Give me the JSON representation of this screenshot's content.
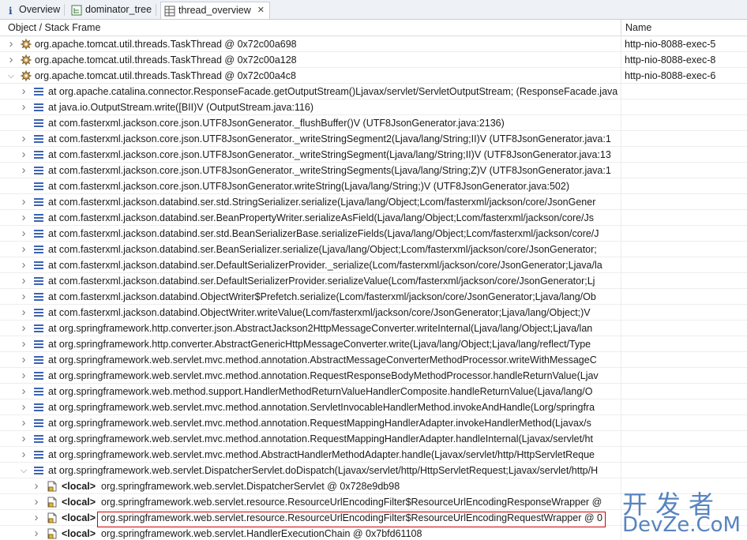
{
  "tabs": [
    {
      "label": "Overview",
      "icon": "info-icon"
    },
    {
      "label": "dominator_tree",
      "icon": "tree-table-icon"
    },
    {
      "label": "thread_overview",
      "icon": "thread-table-icon",
      "active": true
    }
  ],
  "columns": {
    "object": "Object / Stack Frame",
    "name": "Name"
  },
  "threads": [
    {
      "label": "org.apache.tomcat.util.threads.TaskThread @ 0x72c00a698",
      "name": "http-nio-8088-exec-5",
      "expanded": false
    },
    {
      "label": "org.apache.tomcat.util.threads.TaskThread @ 0x72c00a128",
      "name": "http-nio-8088-exec-8",
      "expanded": false
    },
    {
      "label": "org.apache.tomcat.util.threads.TaskThread @ 0x72c00a4c8",
      "name": "http-nio-8088-exec-6",
      "expanded": true
    }
  ],
  "frames": [
    {
      "text": "at org.apache.catalina.connector.ResponseFacade.getOutputStream()Ljavax/servlet/ServletOutputStream; (ResponseFacade.java",
      "chevron": true
    },
    {
      "text": "at java.io.OutputStream.write([BII)V (OutputStream.java:116)",
      "chevron": true
    },
    {
      "text": "at com.fasterxml.jackson.core.json.UTF8JsonGenerator._flushBuffer()V (UTF8JsonGenerator.java:2136)",
      "chevron": false
    },
    {
      "text": "at com.fasterxml.jackson.core.json.UTF8JsonGenerator._writeStringSegment2(Ljava/lang/String;II)V (UTF8JsonGenerator.java:1",
      "chevron": true
    },
    {
      "text": "at com.fasterxml.jackson.core.json.UTF8JsonGenerator._writeStringSegment(Ljava/lang/String;II)V (UTF8JsonGenerator.java:13",
      "chevron": true
    },
    {
      "text": "at com.fasterxml.jackson.core.json.UTF8JsonGenerator._writeStringSegments(Ljava/lang/String;Z)V (UTF8JsonGenerator.java:1",
      "chevron": true
    },
    {
      "text": "at com.fasterxml.jackson.core.json.UTF8JsonGenerator.writeString(Ljava/lang/String;)V (UTF8JsonGenerator.java:502)",
      "chevron": false
    },
    {
      "text": "at com.fasterxml.jackson.databind.ser.std.StringSerializer.serialize(Ljava/lang/Object;Lcom/fasterxml/jackson/core/JsonGener",
      "chevron": true
    },
    {
      "text": "at com.fasterxml.jackson.databind.ser.BeanPropertyWriter.serializeAsField(Ljava/lang/Object;Lcom/fasterxml/jackson/core/Js",
      "chevron": true
    },
    {
      "text": "at com.fasterxml.jackson.databind.ser.std.BeanSerializerBase.serializeFields(Ljava/lang/Object;Lcom/fasterxml/jackson/core/J",
      "chevron": true
    },
    {
      "text": "at com.fasterxml.jackson.databind.ser.BeanSerializer.serialize(Ljava/lang/Object;Lcom/fasterxml/jackson/core/JsonGenerator;",
      "chevron": true
    },
    {
      "text": "at com.fasterxml.jackson.databind.ser.DefaultSerializerProvider._serialize(Lcom/fasterxml/jackson/core/JsonGenerator;Ljava/la",
      "chevron": true
    },
    {
      "text": "at com.fasterxml.jackson.databind.ser.DefaultSerializerProvider.serializeValue(Lcom/fasterxml/jackson/core/JsonGenerator;Lj",
      "chevron": true
    },
    {
      "text": "at com.fasterxml.jackson.databind.ObjectWriter$Prefetch.serialize(Lcom/fasterxml/jackson/core/JsonGenerator;Ljava/lang/Ob",
      "chevron": true
    },
    {
      "text": "at com.fasterxml.jackson.databind.ObjectWriter.writeValue(Lcom/fasterxml/jackson/core/JsonGenerator;Ljava/lang/Object;)V",
      "chevron": true
    },
    {
      "text": "at org.springframework.http.converter.json.AbstractJackson2HttpMessageConverter.writeInternal(Ljava/lang/Object;Ljava/lan",
      "chevron": true
    },
    {
      "text": "at org.springframework.http.converter.AbstractGenericHttpMessageConverter.write(Ljava/lang/Object;Ljava/lang/reflect/Type",
      "chevron": true
    },
    {
      "text": "at org.springframework.web.servlet.mvc.method.annotation.AbstractMessageConverterMethodProcessor.writeWithMessageC",
      "chevron": true
    },
    {
      "text": "at org.springframework.web.servlet.mvc.method.annotation.RequestResponseBodyMethodProcessor.handleReturnValue(Ljav",
      "chevron": true
    },
    {
      "text": "at org.springframework.web.method.support.HandlerMethodReturnValueHandlerComposite.handleReturnValue(Ljava/lang/O",
      "chevron": true
    },
    {
      "text": "at org.springframework.web.servlet.mvc.method.annotation.ServletInvocableHandlerMethod.invokeAndHandle(Lorg/springfra",
      "chevron": true
    },
    {
      "text": "at org.springframework.web.servlet.mvc.method.annotation.RequestMappingHandlerAdapter.invokeHandlerMethod(Ljavax/s",
      "chevron": true
    },
    {
      "text": "at org.springframework.web.servlet.mvc.method.annotation.RequestMappingHandlerAdapter.handleInternal(Ljavax/servlet/ht",
      "chevron": true
    },
    {
      "text": "at org.springframework.web.servlet.mvc.method.AbstractHandlerMethodAdapter.handle(Ljavax/servlet/http/HttpServletReque",
      "chevron": true
    },
    {
      "text": "at org.springframework.web.servlet.DispatcherServlet.doDispatch(Ljavax/servlet/http/HttpServletRequest;Ljavax/servlet/http/H",
      "chevron": true,
      "expanded": true
    }
  ],
  "locals": [
    {
      "tag": "<local>",
      "text": "org.springframework.web.servlet.DispatcherServlet @ 0x728e9db98"
    },
    {
      "tag": "<local>",
      "text": "org.springframework.web.servlet.resource.ResourceUrlEncodingFilter$ResourceUrlEncodingResponseWrapper @"
    },
    {
      "tag": "<local>",
      "text": "org.springframework.web.servlet.resource.ResourceUrlEncodingFilter$ResourceUrlEncodingRequestWrapper @ 0",
      "highlighted": true
    },
    {
      "tag": "<local>",
      "text": "org.springframework.web.servlet.HandlerExecutionChain @ 0x7bfd61108"
    }
  ],
  "watermark": {
    "top": "开发者",
    "bottom": "DevZe.CoM"
  },
  "colors": {
    "highlight_border": "#d20000",
    "watermark": "#3a6fb5",
    "frame_icon": "#3b63b5"
  }
}
